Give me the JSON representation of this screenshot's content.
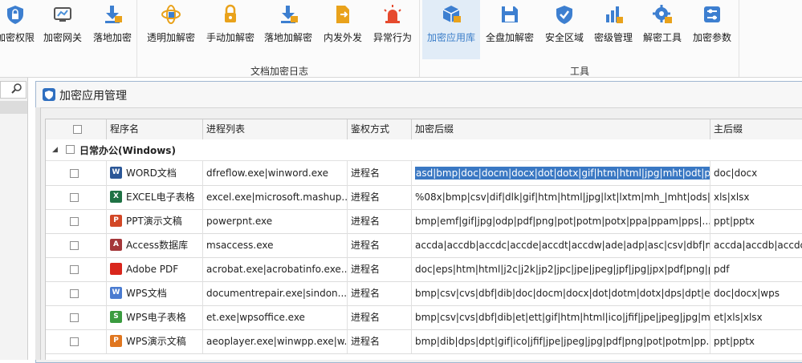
{
  "ribbon": {
    "groups": [
      {
        "label": "",
        "buttons": [
          {
            "id": "perm",
            "label": "加密权限",
            "icon": "shield-lock-icon",
            "color": "#3d7fd0"
          },
          {
            "id": "gateway",
            "label": "加密网关",
            "icon": "gateway-monitor-icon",
            "color": "#4a90d9"
          },
          {
            "id": "landing",
            "label": "落地加密",
            "icon": "download-lock-icon",
            "color": "#3d7fd0"
          }
        ]
      },
      {
        "label": "文档加密日志",
        "buttons": [
          {
            "id": "transparent",
            "label": "透明加解密",
            "icon": "atom-lock-icon",
            "color": "#e9a21b"
          },
          {
            "id": "manual",
            "label": "手动加解密",
            "icon": "hand-lock-icon",
            "color": "#e9a21b"
          },
          {
            "id": "landing2",
            "label": "落地加解密",
            "icon": "download-lock-icon",
            "color": "#3d7fd0"
          },
          {
            "id": "outgoing",
            "label": "内发外发",
            "icon": "document-send-icon",
            "color": "#e9a21b"
          },
          {
            "id": "abnormal",
            "label": "异常行为",
            "icon": "alarm-light-icon",
            "color": "#e64a2e"
          }
        ]
      },
      {
        "label": "工具",
        "buttons": [
          {
            "id": "apps",
            "label": "加密应用库",
            "icon": "cube-lock-icon",
            "color": "#3d7fd0",
            "active": true
          },
          {
            "id": "fulldisk",
            "label": "全盘加解密",
            "icon": "floppy-lock-icon",
            "color": "#3d7fd0"
          },
          {
            "id": "safezone",
            "label": "安全区域",
            "icon": "shield-check-icon",
            "color": "#3d7fd0"
          },
          {
            "id": "level",
            "label": "密级管理",
            "icon": "bar-chart-lock-icon",
            "color": "#3d7fd0"
          },
          {
            "id": "tools",
            "label": "解密工具",
            "icon": "gear-lock-icon",
            "color": "#3d7fd0"
          },
          {
            "id": "params",
            "label": "加密参数",
            "icon": "sliders-icon",
            "color": "#3d7fd0"
          }
        ]
      }
    ]
  },
  "window": {
    "title": "加密应用管理",
    "columns": [
      "程序名",
      "进程列表",
      "鉴权方式",
      "加密后缀",
      "主后缀"
    ],
    "group": {
      "label": "日常办公(Windows)"
    },
    "rows": [
      {
        "name": "WORD文档",
        "icon": "word-icon",
        "icon_color": "#2b5797",
        "icon_letter": "W",
        "processes": "dfreflow.exe|winword.exe",
        "auth": "进程名",
        "suffix": "asd|bmp|doc|docm|docx|dot|dotx|gif|htm|html|jpg|mht|odt|pdf|",
        "main": "doc|docx",
        "selected": true
      },
      {
        "name": "EXCEL电子表格",
        "icon": "excel-icon",
        "icon_color": "#1f7244",
        "icon_letter": "X",
        "processes": "excel.exe|microsoft.mashup....",
        "auth": "进程名",
        "suffix": "%08x|bmp|csv|dif|dlk|gif|htm|html|jpg|lxt|lxtm|mh_|mht|ods|p...",
        "main": "xls|xlsx"
      },
      {
        "name": "PPT演示文稿",
        "icon": "powerpoint-icon",
        "icon_color": "#d24726",
        "icon_letter": "P",
        "processes": "powerpnt.exe",
        "auth": "进程名",
        "suffix": "bmp|emf|gif|jpg|odp|pdf|png|pot|potm|potx|ppa|ppam|pps|...",
        "main": "ppt|pptx"
      },
      {
        "name": "Access数据库",
        "icon": "access-icon",
        "icon_color": "#a4373a",
        "icon_letter": "A",
        "processes": "msaccess.exe",
        "auth": "进程名",
        "suffix": "accda|accdb|accdc|accde|accdt|accdw|ade|adp|asc|csv|dbf|m...",
        "main": "accda|accdb|accdc"
      },
      {
        "name": "Adobe PDF",
        "icon": "adobe-pdf-icon",
        "icon_color": "#d9261c",
        "icon_letter": "",
        "processes": "acrobat.exe|acrobatinfo.exe...",
        "auth": "进程名",
        "suffix": "doc|eps|htm|html|j2c|j2k|jp2|jpc|jpe|jpeg|jpf|jpg|jpx|pdf|png|p...",
        "main": "pdf"
      },
      {
        "name": "WPS文档",
        "icon": "wps-writer-icon",
        "icon_color": "#4a7bd0",
        "icon_letter": "W",
        "processes": "documentrepair.exe|sindon...",
        "auth": "进程名",
        "suffix": "bmp|csv|cvs|dbf|dib|doc|docm|docx|dot|dotm|dotx|dps|dpt|e...",
        "main": "doc|docx|wps"
      },
      {
        "name": "WPS电子表格",
        "icon": "wps-spreadsheet-icon",
        "icon_color": "#3a9b3f",
        "icon_letter": "S",
        "processes": "et.exe|wpsoffice.exe",
        "auth": "进程名",
        "suffix": "bmp|csv|cvs|dbf|dib|et|ett|gif|htm|html|ico|jfif|jpe|jpeg|jpg|mh...",
        "main": "et|xls|xlsx"
      },
      {
        "name": "WPS演示文稿",
        "icon": "wps-presentation-icon",
        "icon_color": "#e0761f",
        "icon_letter": "P",
        "processes": "aeoplayer.exe|winwpp.exe|w...",
        "auth": "进程名",
        "suffix": "bmp|dib|dps|dpt|gif|ico|jfif|jpe|jpeg|jpg|pdf|png|pot|potm|pp...",
        "main": "ppt|pptx"
      }
    ]
  }
}
